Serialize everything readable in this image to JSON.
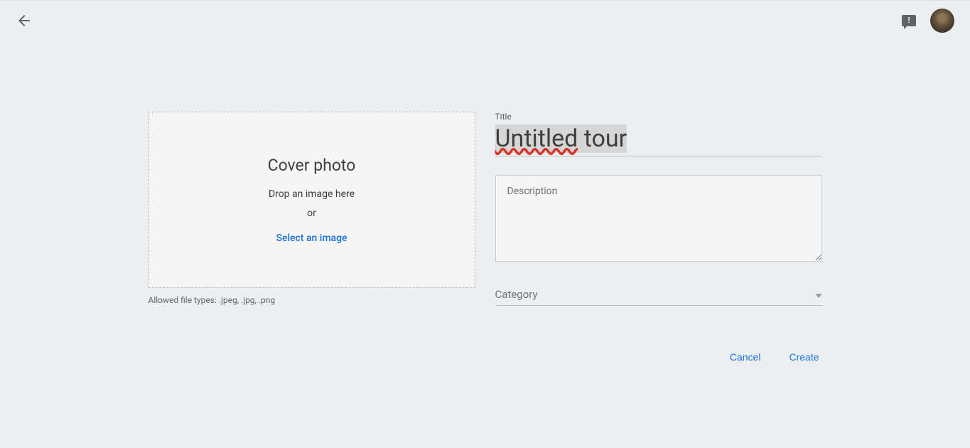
{
  "header": {
    "back_icon": "arrow-back"
  },
  "cover_photo": {
    "title": "Cover photo",
    "drop_text": "Drop an image here",
    "or_text": "or",
    "select_link": "Select an image",
    "allowed_types": "Allowed file types: .jpeg, .jpg, .png"
  },
  "form": {
    "title_label": "Title",
    "title_value_underlined": "Untitled",
    "title_value_plain": " tour",
    "description_placeholder": "Description",
    "description_value": "",
    "category_label": "Category"
  },
  "actions": {
    "cancel": "Cancel",
    "create": "Create"
  }
}
